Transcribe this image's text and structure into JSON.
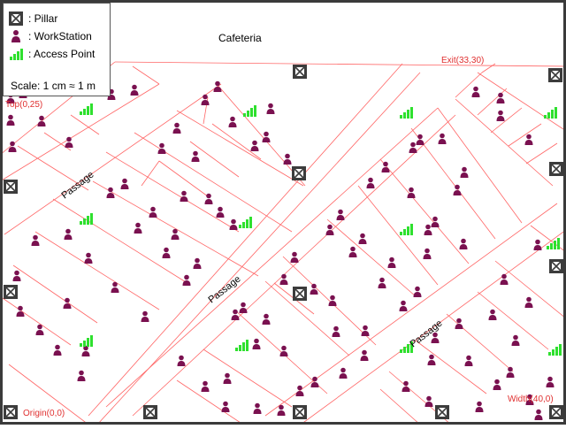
{
  "legend": {
    "pillar": ": Pillar",
    "workstation": ": WorkStation",
    "access_point": ": Access Point",
    "scale": "Scale: 1 cm ≈ 1 m"
  },
  "labels": {
    "cafeteria": "Cafeteria",
    "top": "Top(0,25)",
    "exit": "Exit(33,30)",
    "origin": "Origin(0,0)",
    "width": "Width(40,0)",
    "passage": "Passage"
  },
  "colors": {
    "wall": "#ff6666",
    "label_red": "#e03030",
    "workstation": "#7a1150",
    "access_point": "#2ee02e",
    "pillar": "#3c3c3c"
  }
}
